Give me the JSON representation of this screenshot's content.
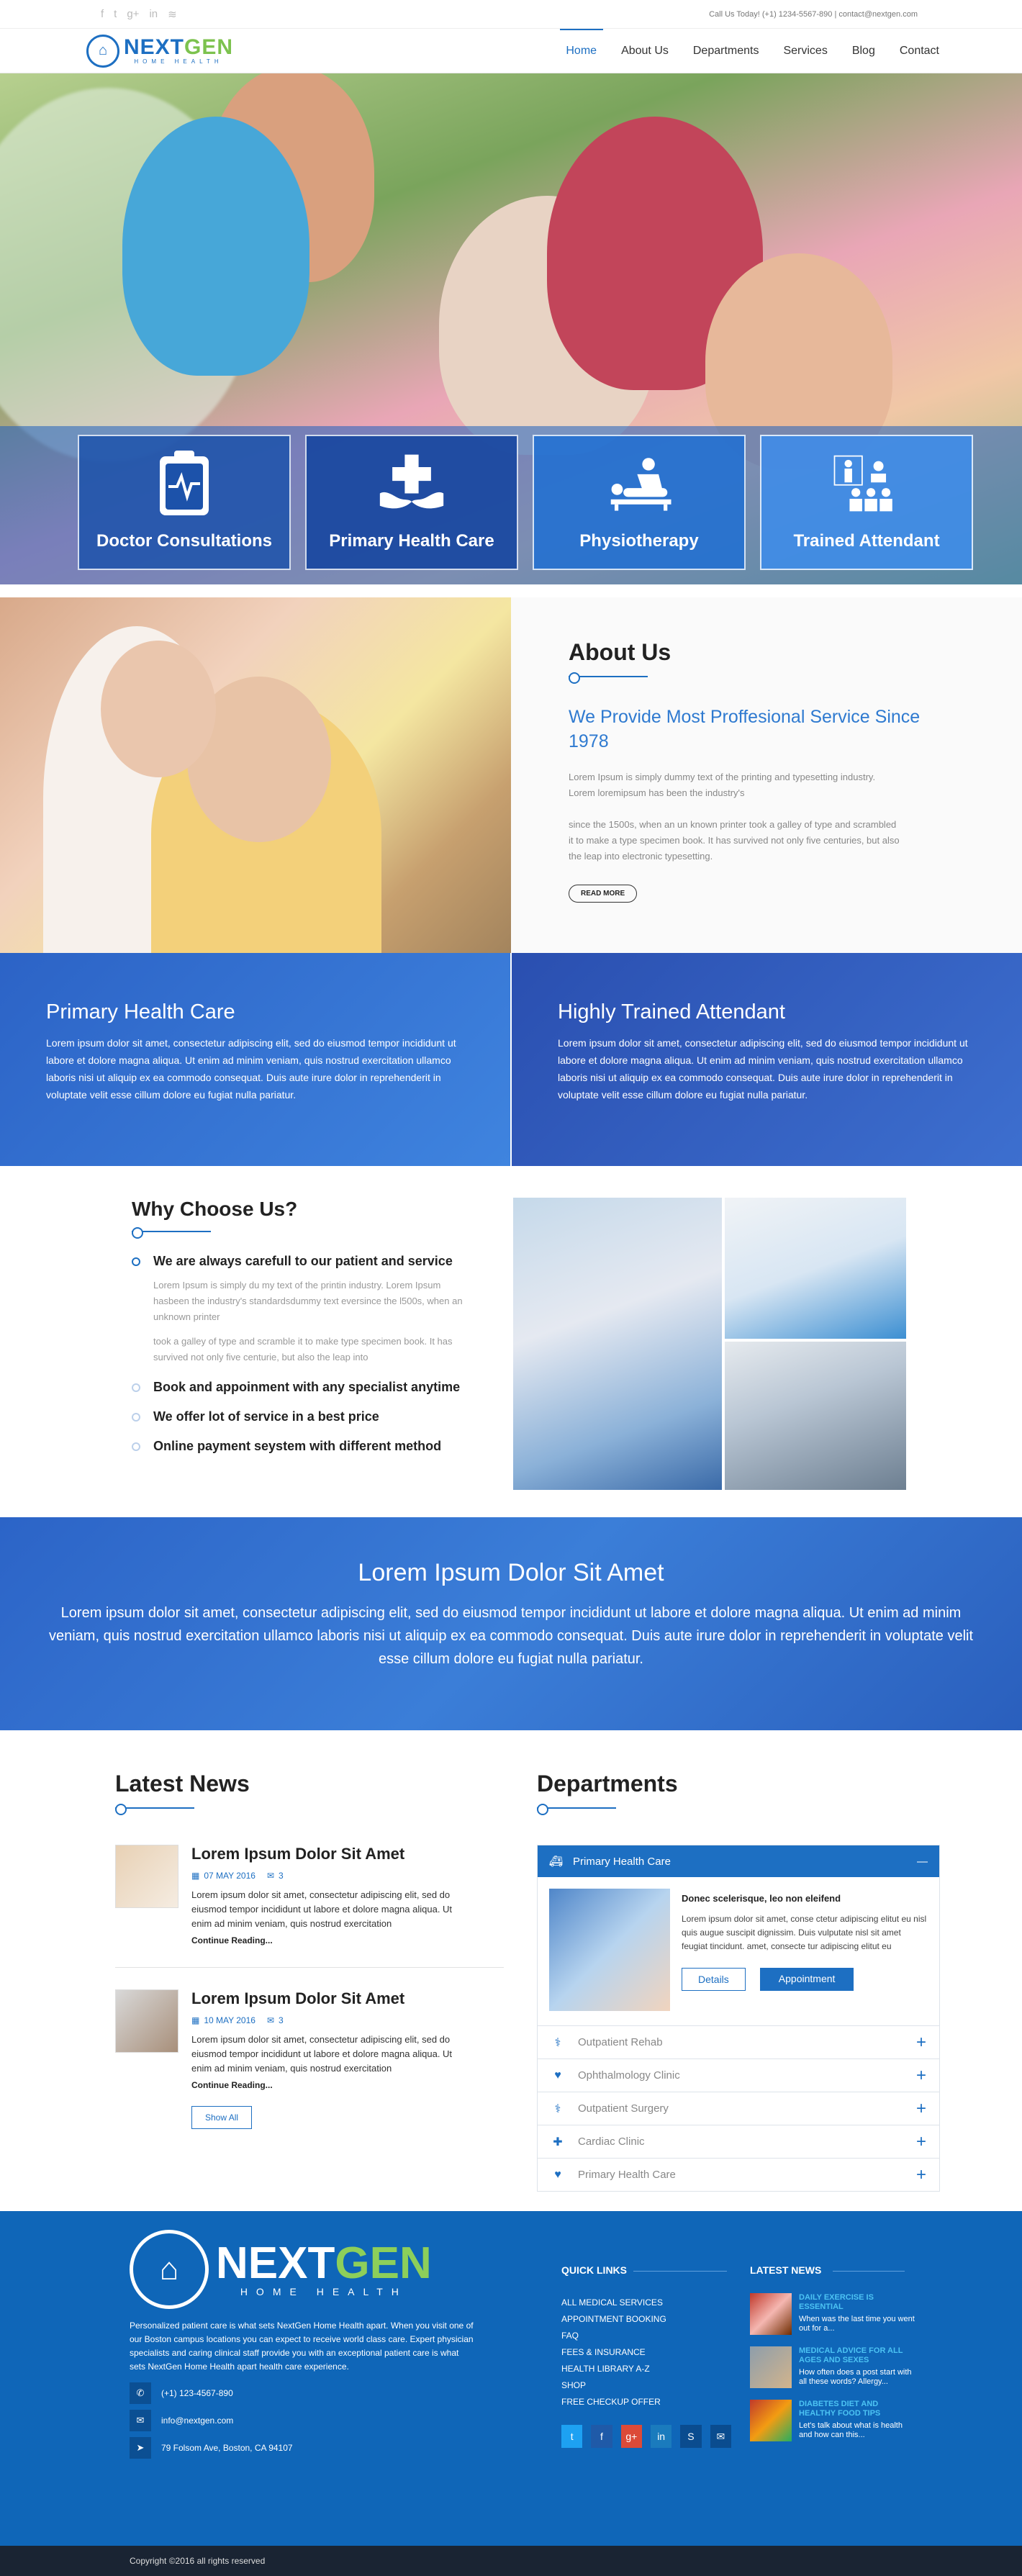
{
  "topbar": {
    "contact_text": "Call Us Today! (+1) 1234-5567-890 | contact@nextgen.com",
    "social_icons": [
      "facebook-icon",
      "twitter-icon",
      "google-plus-icon",
      "linkedin-icon",
      "rss-icon"
    ]
  },
  "brand": {
    "name_a": "NEXT",
    "name_b": "GEN",
    "tagline": "HOME HEALTH",
    "accent": "#1d6fc2",
    "green": "#7cc24e"
  },
  "nav": {
    "items": [
      "Home",
      "About Us",
      "Departments",
      "Services",
      "Blog",
      "Contact"
    ],
    "active": "Home"
  },
  "services": [
    {
      "title": "Doctor Consultations",
      "icon": "clipboard-heartbeat-icon"
    },
    {
      "title": "Primary Health Care",
      "icon": "medical-hands-icon"
    },
    {
      "title": "Physiotherapy",
      "icon": "massage-icon"
    },
    {
      "title": "Trained Attendant",
      "icon": "attendant-group-icon"
    }
  ],
  "about": {
    "title": "About Us",
    "subtitle": "We Provide Most Proffesional Service Since 1978",
    "p1": "Lorem Ipsum is simply dummy text of the printing and typesetting industry. Lorem loremipsum has been the industry's",
    "p2": "since the 1500s, when an un known printer took a galley of type and scrambled it to make a type specimen book. It has survived not only five centuries, but also the leap into electronic typesetting.",
    "button": "READ MORE"
  },
  "panels": [
    {
      "title": "Primary Health Care",
      "text": "Lorem ipsum dolor sit amet, consectetur adipiscing elit, sed do eiusmod tempor incididunt ut labore et dolore magna aliqua. Ut enim ad minim veniam, quis nostrud exercitation ullamco laboris nisi ut aliquip ex ea commodo consequat. Duis aute irure dolor in reprehenderit in voluptate velit esse cillum dolore eu fugiat nulla pariatur."
    },
    {
      "title": "Highly Trained Attendant",
      "text": "Lorem ipsum dolor sit amet, consectetur adipiscing elit, sed do eiusmod tempor incididunt ut labore et dolore magna aliqua. Ut enim ad minim veniam, quis nostrud exercitation ullamco laboris nisi ut aliquip ex ea commodo consequat. Duis aute irure dolor in reprehenderit in voluptate velit esse cillum dolore eu fugiat nulla pariatur."
    }
  ],
  "why": {
    "title": "Why Choose Us?",
    "items": [
      {
        "title": "We are always carefull to our patient and service",
        "d1": "Lorem Ipsum is simply du my text of the printin industry. Lorem Ipsum hasbeen the industry's standardsdummy text eversince the l500s, when an unknown printer",
        "d2": "took a galley of type and scramble it to make type specimen book. It has survived not only five centurie, but also the leap into"
      },
      {
        "title": "Book and appoinment with any specialist anytime"
      },
      {
        "title": "We offer lot of service in a best price"
      },
      {
        "title": "Online payment seystem with different method"
      }
    ]
  },
  "band": {
    "title": "Lorem Ipsum Dolor Sit Amet",
    "text": "Lorem ipsum dolor sit amet, consectetur adipiscing elit, sed do eiusmod tempor incididunt ut labore et dolore magna aliqua. Ut enim ad minim veniam, quis nostrud exercitation ullamco laboris nisi ut aliquip ex ea commodo consequat. Duis aute irure dolor in reprehenderit in voluptate velit esse cillum dolore eu fugiat nulla pariatur."
  },
  "news": {
    "title": "Latest News",
    "items": [
      {
        "title": "Lorem Ipsum Dolor Sit Amet",
        "date": "07 MAY 2016",
        "comments": "3",
        "text": "Lorem ipsum dolor sit amet, consectetur adipiscing elit, sed do eiusmod tempor incididunt ut labore et dolore magna aliqua. Ut enim ad minim veniam, quis nostrud exercitation",
        "more": "Continue Reading..."
      },
      {
        "title": "Lorem Ipsum Dolor Sit Amet",
        "date": "10 MAY 2016",
        "comments": "3",
        "text": "Lorem ipsum dolor sit amet, consectetur adipiscing elit, sed do eiusmod tempor incididunt ut labore et dolore magna aliqua. Ut enim ad minim veniam, quis nostrud exercitation",
        "more": "Continue Reading..."
      }
    ],
    "show_all": "Show All"
  },
  "departments": {
    "title": "Departments",
    "open": {
      "name": "Primary Health Care",
      "heading": "Donec scelerisque, leo non eleifend",
      "text": "Lorem ipsum dolor sit amet, conse ctetur adipiscing elitut eu nisl quis augue suscipit dignissim. Duis vulputate nisl sit amet feugiat tincidunt. amet, consecte tur adipiscing elitut eu",
      "btn_details": "Details",
      "btn_appt": "Appointment"
    },
    "rows": [
      {
        "name": "Outpatient Rehab",
        "icon": "stethoscope-icon"
      },
      {
        "name": "Ophthalmology Clinic",
        "icon": "heart-icon"
      },
      {
        "name": "Outpatient Surgery",
        "icon": "stethoscope-icon"
      },
      {
        "name": "Cardiac Clinic",
        "icon": "medkit-icon"
      },
      {
        "name": "Primary Health Care",
        "icon": "heart-icon"
      }
    ]
  },
  "footer": {
    "about": "Personalized patient care is what sets NextGen Home Health apart. When you visit one of our Boston campus locations you can expect to receive world class care. Expert physician specialists and caring clinical staff provide you with an exceptional patient care is what sets NextGen Home Health apart health care experience.",
    "phone": "(+1) 123-4567-890",
    "email": "info@nextgen.com",
    "address": "79 Folsom Ave, Boston, CA 94107",
    "quick_links_title": "QUICK LINKS",
    "quick_links": [
      "ALL MEDICAL SERVICES",
      "APPOINTMENT BOOKING",
      "FAQ",
      "FEES & INSURANCE",
      "HEALTH LIBRARY A-Z",
      "SHOP",
      "FREE CHECKUP OFFER"
    ],
    "latest_news_title": "LATEST NEWS",
    "news": [
      {
        "title": "DAILY EXERCISE IS ESSENTIAL",
        "text": "When was the last time you went out for a..."
      },
      {
        "title": "MEDICAL ADVICE FOR ALL AGES AND SEXES",
        "text": "How often does a post start with all these words? Allergy..."
      },
      {
        "title": "DIABETES DIET AND HEALTHY FOOD TIPS",
        "text": "Let's talk about what is health and how can this..."
      }
    ],
    "copyright": "Copyright ©2016 all rights reserved"
  }
}
